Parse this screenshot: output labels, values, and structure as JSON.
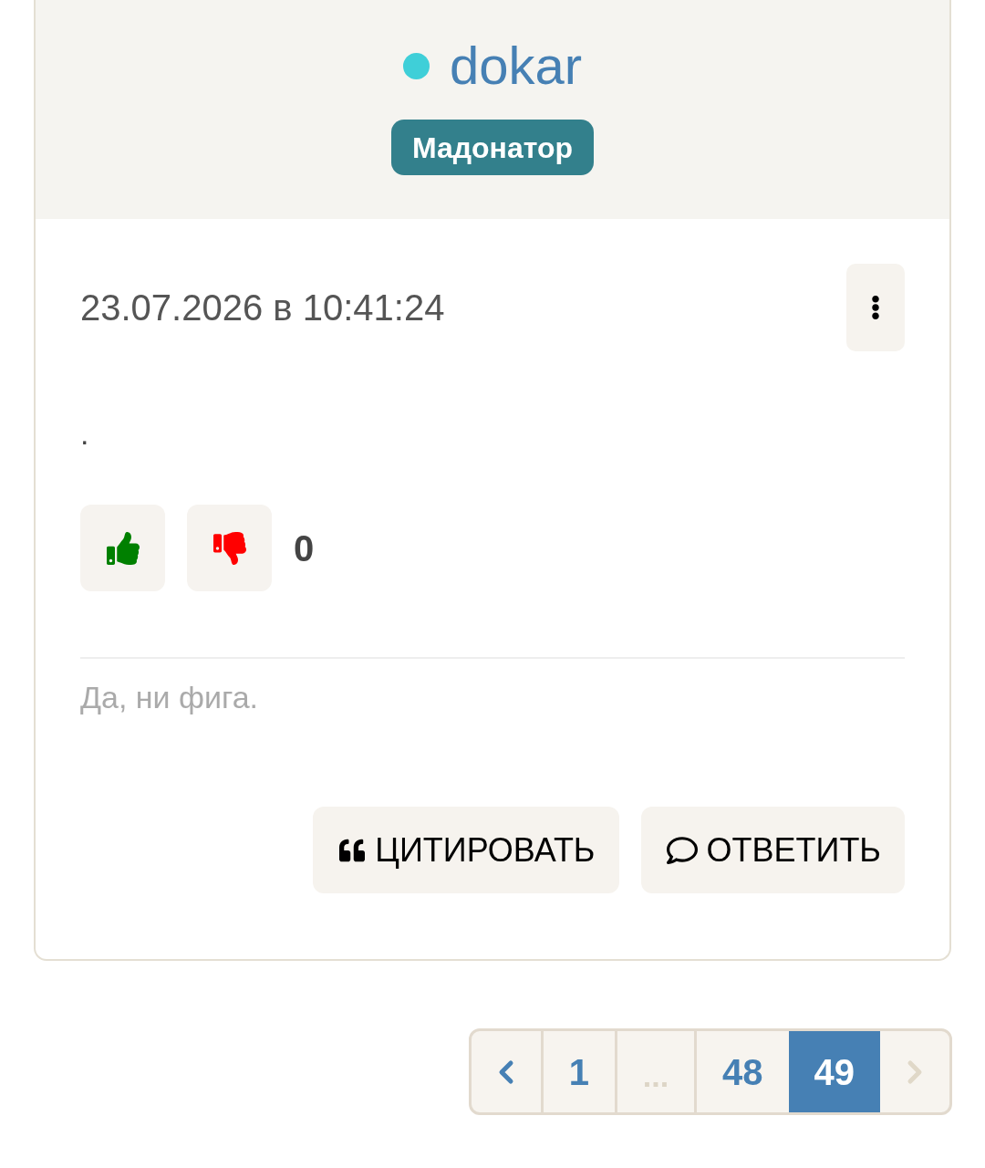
{
  "author": {
    "name": "dokar",
    "online": true,
    "badge": "Мадонатор"
  },
  "post": {
    "timestamp": "23.07.2026 в 10:41:24",
    "body": ".",
    "score": "0",
    "signature": "Да, ни фига."
  },
  "actions": [
    {
      "kind": "quote",
      "label": "ЦИТИРОВАТЬ"
    },
    {
      "kind": "reply",
      "label": "ОТВЕТИТЬ"
    }
  ],
  "pagination": {
    "prev": {
      "disabled": false
    },
    "pages": [
      {
        "kind": "page",
        "label": "1",
        "selected": false
      },
      {
        "kind": "ellipsis",
        "label": "..."
      },
      {
        "kind": "page",
        "label": "48",
        "selected": false
      },
      {
        "kind": "page",
        "label": "49",
        "selected": true
      }
    ],
    "next": {
      "disabled": true
    }
  }
}
